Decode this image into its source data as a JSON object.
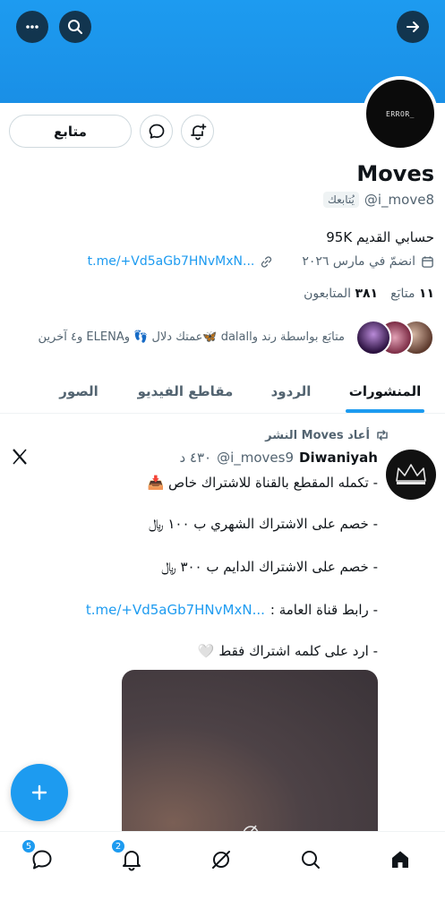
{
  "header": {
    "follow_label": "متابع"
  },
  "profile": {
    "avatar_text": "ERROR_",
    "name": "Moves",
    "handle": "@i_move8",
    "follows_you": "يُتابعك",
    "bio": "حسابي القديم 95K",
    "link": "t.me/+Vd5aGb7HNvMxN...",
    "joined": "انضمّ في مارس ٢٠٢٦",
    "following_count": "١١",
    "following_label": "متابَع",
    "followers_count": "٣٨١",
    "followers_label": "المتابعون",
    "followed_by_text": "متابَع بواسطة رند واdalal 🦋عمتك دلال 👣 وELENA و٤ آخرين"
  },
  "tabs": [
    {
      "label": "المنشورات",
      "active": true
    },
    {
      "label": "الردود",
      "active": false
    },
    {
      "label": "مقاطع الفيديو",
      "active": false
    },
    {
      "label": "الصور",
      "active": false
    }
  ],
  "post": {
    "repost_label": "أعاد Moves النشر",
    "author_name": "Diwaniyah",
    "author_handle": "@i_moves9",
    "time": "٤٣٠ د",
    "lines": [
      "- تكمله المقطع بالقناة للاشتراك خاص 📥",
      "- خصم على الاشتراك الشهري ب ١٠٠ ﷼",
      "- خصم على الاشتراك الدايم ب ٣٠٠ ﷼",
      "- رابط قناة العامة :",
      "- ارد على كلمه اشتراك فقط 🤍"
    ],
    "channel_link": "t.me/+Vd5aGb7HNvMxN..."
  },
  "bottom_nav": {
    "messages_badge": "5",
    "notifications_badge": "2"
  },
  "colors": {
    "accent": "#1d9bf0",
    "banner": "#1d9bf0"
  }
}
